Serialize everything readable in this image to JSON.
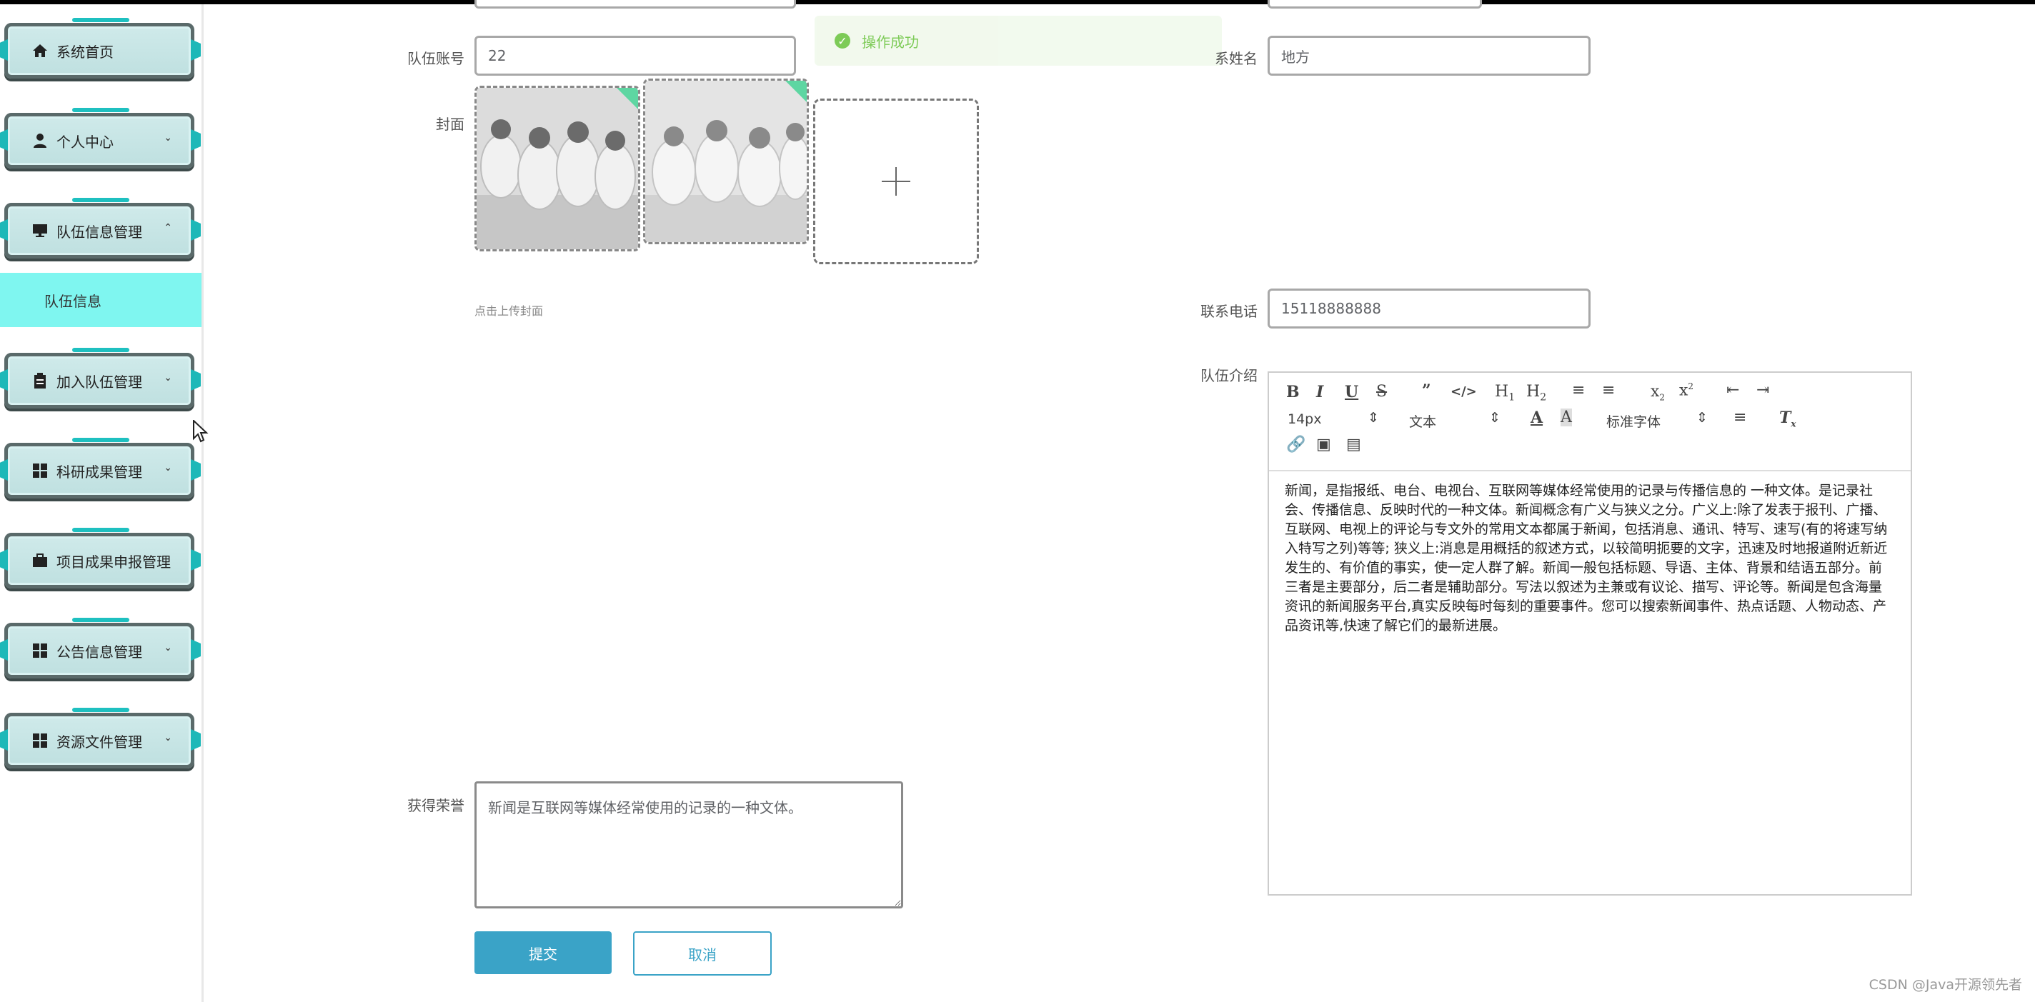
{
  "sidebar": {
    "items": [
      {
        "label": "系统首页",
        "icon": "home-icon"
      },
      {
        "label": "个人中心",
        "icon": "user-icon"
      },
      {
        "label": "队伍信息管理",
        "icon": "monitor-icon"
      },
      {
        "label": "加入队伍管理",
        "icon": "clipboard-icon"
      },
      {
        "label": "科研成果管理",
        "icon": "grid-icon"
      },
      {
        "label": "项目成果申报管理",
        "icon": "briefcase-icon"
      },
      {
        "label": "公告信息管理",
        "icon": "grid-icon"
      },
      {
        "label": "资源文件管理",
        "icon": "grid-icon"
      }
    ],
    "submenu": {
      "label": "队伍信息"
    }
  },
  "toast": {
    "message": "操作成功"
  },
  "form": {
    "team_account_label": "队伍账号",
    "team_account_value": "22",
    "contact_name_label": "系姓名",
    "contact_name_value": "地方",
    "cover_label": "封面",
    "cover_hint": "点击上传封面",
    "phone_label": "联系电话",
    "phone_value": "15118888888",
    "intro_label": "队伍介绍",
    "honors_label": "获得荣誉",
    "honors_value": "新闻是互联网等媒体经常使用的记录的一种文体。",
    "submit_label": "提交",
    "cancel_label": "取消"
  },
  "editor": {
    "font_size": "14px",
    "paragraph": "文本",
    "font_family": "标准字体",
    "content": "新闻，是指报纸、电台、电视台、互联网等媒体经常使用的记录与传播信息的 一种文体。是记录社会、传播信息、反映时代的一种文体。新闻概念有广义与狭义之分。广义上:除了发表于报刊、广播、互联网、电视上的评论与专文外的常用文本都属于新闻，包括消息、通讯、特写、速写(有的将速写纳入特写之列)等等; 狭义上:消息是用概括的叙述方式，以较简明扼要的文字，迅速及时地报道附近新近发生的、有价值的事实，使一定人群了解。新闻一般包括标题、导语、主体、背景和结语五部分。前三者是主要部分，后二者是辅助部分。写法以叙述为主兼或有议论、描写、评论等。新闻是包含海量资讯的新闻服务平台,真实反映每时每刻的重要事件。您可以搜索新闻事件、热点话题、人物动态、产品资讯等,快速了解它们的最新进展。"
  },
  "watermark": "CSDN @Java开源领先者"
}
